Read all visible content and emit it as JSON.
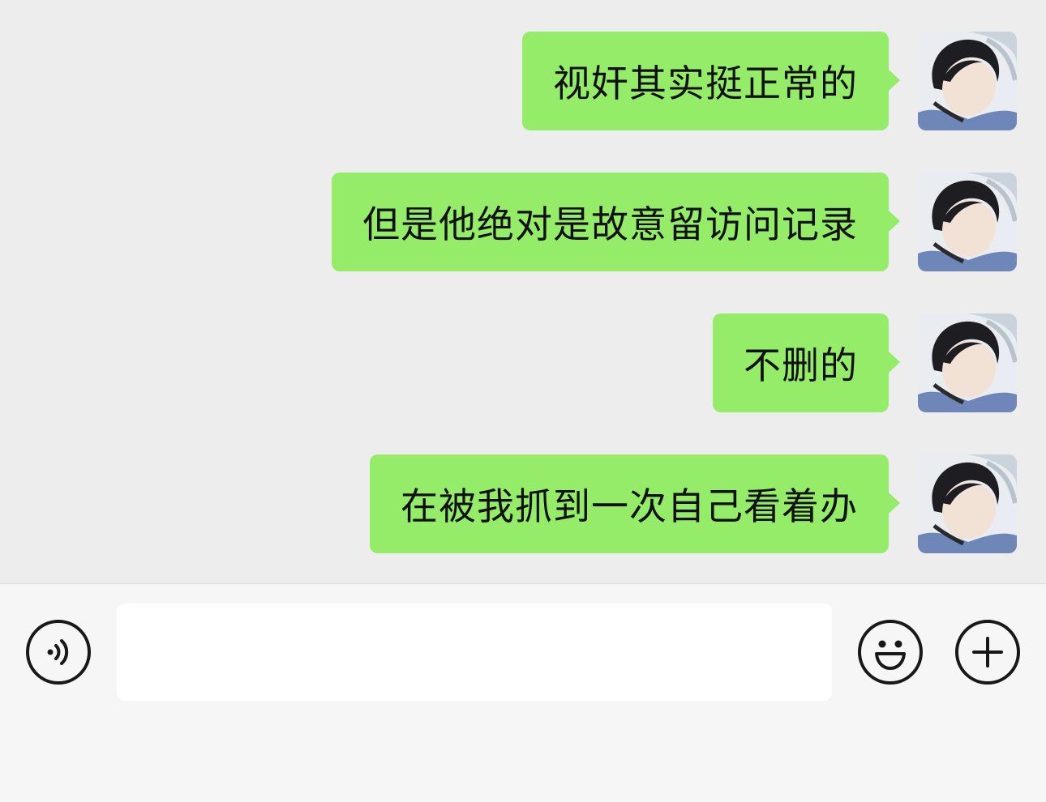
{
  "chat": {
    "messages": [
      {
        "text": "视奸其实挺正常的",
        "sender": "self"
      },
      {
        "text": "但是他绝对是故意留访问记录",
        "sender": "self"
      },
      {
        "text": "不删的",
        "sender": "self"
      },
      {
        "text": "在被我抓到一次自己看着办",
        "sender": "self"
      }
    ]
  },
  "input_bar": {
    "message_value": "",
    "voice_icon": "voice-icon",
    "emoji_icon": "emoji-icon",
    "plus_icon": "plus-icon"
  },
  "colors": {
    "background": "#ededed",
    "bubble_self": "#95ec69",
    "input_bar": "#f6f6f6"
  }
}
